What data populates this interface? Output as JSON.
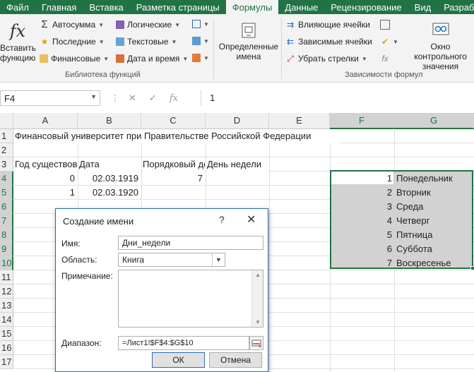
{
  "tabs": [
    "Файл",
    "Главная",
    "Вставка",
    "Разметка страницы",
    "Формулы",
    "Данные",
    "Рецензирование",
    "Вид",
    "Разработчик"
  ],
  "active_tab": "Формулы",
  "ribbon": {
    "insert_function": "Вставить функцию",
    "autosum": "Автосумма",
    "recent": "Последние",
    "financial": "Финансовые",
    "logical": "Логические",
    "text": "Текстовые",
    "datetime": "Дата и время",
    "library_label": "Библиотека функций",
    "defined_names": "Определенные имена",
    "trace_precedents": "Влияющие ячейки",
    "trace_dependents": "Зависимые ячейки",
    "remove_arrows": "Убрать стрелки",
    "watch_window": "Окно контрольного значения",
    "audit_label": "Зависимости формул"
  },
  "formula_bar": {
    "name_box": "F4",
    "fx": "fx",
    "value": "1"
  },
  "columns": [
    "A",
    "B",
    "C",
    "D",
    "E",
    "F",
    "G"
  ],
  "rows": [
    "1",
    "2",
    "3",
    "4",
    "5",
    "6",
    "7",
    "8",
    "9",
    "10",
    "11",
    "12",
    "13",
    "14",
    "15",
    "16",
    "17"
  ],
  "cells": {
    "A1": "Финансовый университет при Правительстве Российской Федерации",
    "A3": "Год существования",
    "B3": "Дата",
    "C3": "Порядковый день",
    "D3": "День недели",
    "A4": "0",
    "B4": "02.03.1919",
    "C4": "7",
    "A5": "1",
    "B5": "02.03.1920"
  },
  "range_rows": [
    {
      "num": "1",
      "day": "Понедельник"
    },
    {
      "num": "2",
      "day": "Вторник"
    },
    {
      "num": "3",
      "day": "Среда"
    },
    {
      "num": "4",
      "day": "Четверг"
    },
    {
      "num": "5",
      "day": "Пятница"
    },
    {
      "num": "6",
      "day": "Суббота"
    },
    {
      "num": "7",
      "day": "Воскресенье"
    }
  ],
  "dialog": {
    "title": "Создание имени",
    "help": "?",
    "close": "✕",
    "name_label": "Имя:",
    "name_value": "Дни_недели",
    "scope_label": "Область:",
    "scope_value": "Книга",
    "comment_label": "Примечание:",
    "range_label": "Диапазон:",
    "range_value": "=Лист1!$F$4:$G$10",
    "ok": "ОК",
    "cancel": "Отмена"
  },
  "colors": {
    "accent": "#217346",
    "selection": "#d2d2d2",
    "dialog_border": "#2b6cb0"
  }
}
